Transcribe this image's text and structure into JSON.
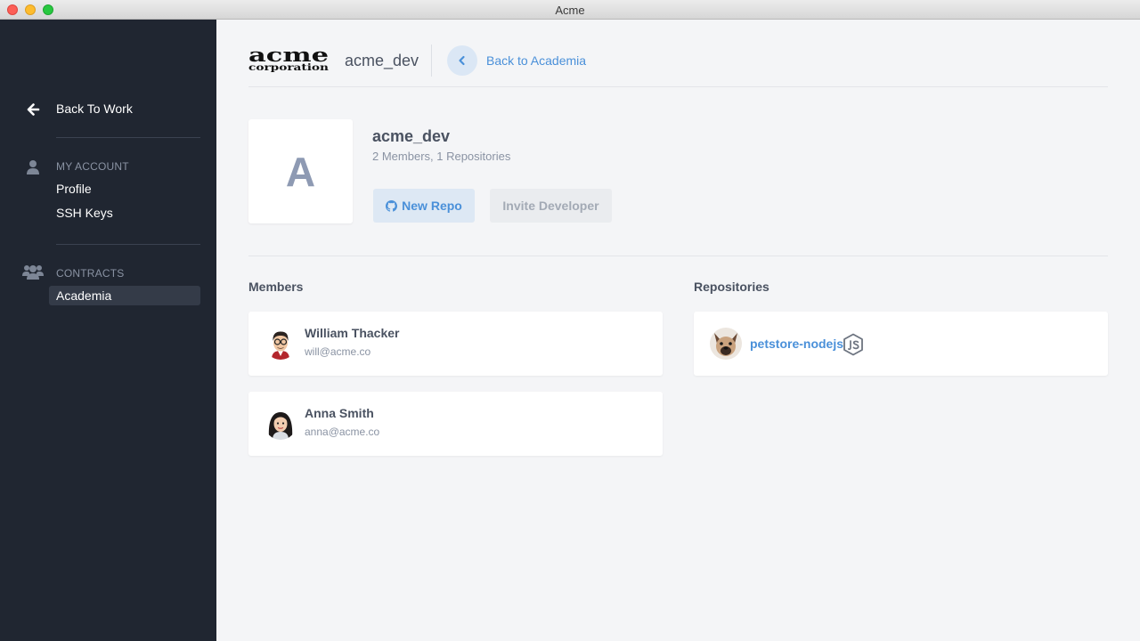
{
  "window": {
    "title": "Acme"
  },
  "sidebar": {
    "back_label": "Back To Work",
    "my_account": {
      "title": "MY ACCOUNT",
      "items": [
        "Profile",
        "SSH Keys"
      ]
    },
    "contracts": {
      "title": "CONTRACTS",
      "items": [
        "Academia"
      ],
      "active": "Academia"
    }
  },
  "header": {
    "logo_top": "acme",
    "logo_bottom": "corporation",
    "org_name": "acme_dev",
    "back_label": "Back to Academia"
  },
  "org": {
    "initial": "A",
    "name": "acme_dev",
    "stats": "2 Members, 1 Repositories",
    "new_repo_label": "New Repo",
    "invite_label": "Invite Developer"
  },
  "members": {
    "title": "Members",
    "items": [
      {
        "name": "William Thacker",
        "email": "will@acme.co"
      },
      {
        "name": "Anna Smith",
        "email": "anna@acme.co"
      }
    ]
  },
  "repositories": {
    "title": "Repositories",
    "items": [
      {
        "name": "petstore-nodejs",
        "language_icon": "nodejs-icon"
      }
    ]
  },
  "colors": {
    "sidebar_bg": "#202631",
    "accent": "#4a90d9",
    "page_bg": "#f4f5f7"
  }
}
